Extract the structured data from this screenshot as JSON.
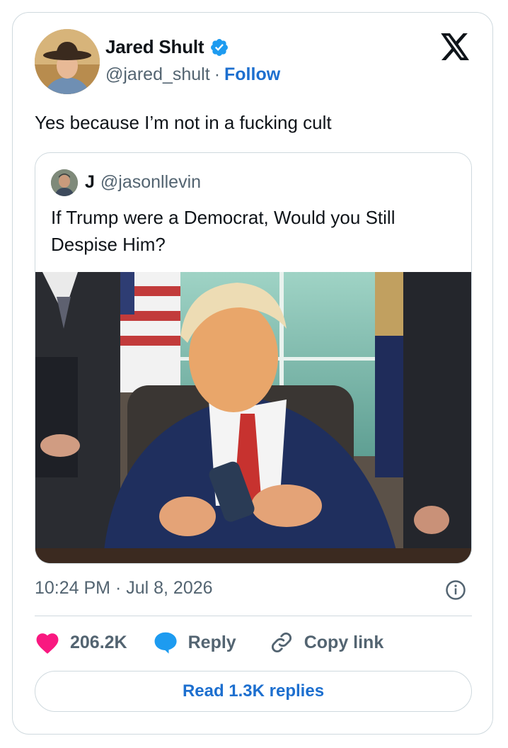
{
  "author": {
    "name": "Jared Shult",
    "handle": "@jared_shult",
    "separator": "·",
    "follow_label": "Follow"
  },
  "tweet": {
    "text": "Yes because I’m not in a fucking cult",
    "timestamp": "10:24 PM · Jul 8, 2026"
  },
  "quoted_tweet": {
    "name": "J",
    "handle": "@jasonllevin",
    "text": "If Trump were a Democrat, Would you Still Despise Him?"
  },
  "actions": {
    "likes": "206.2K",
    "reply_label": "Reply",
    "copy_link_label": "Copy link"
  },
  "read_replies_label": "Read 1.3K replies",
  "colors": {
    "accent": "#1d6fcf",
    "like": "#f91880",
    "reply": "#1d9bf0",
    "muted": "#536471",
    "border": "#cfd9de"
  },
  "icons": [
    "verified-badge-icon",
    "x-logo-icon",
    "info-icon",
    "heart-icon",
    "reply-bubble-icon",
    "link-icon"
  ]
}
